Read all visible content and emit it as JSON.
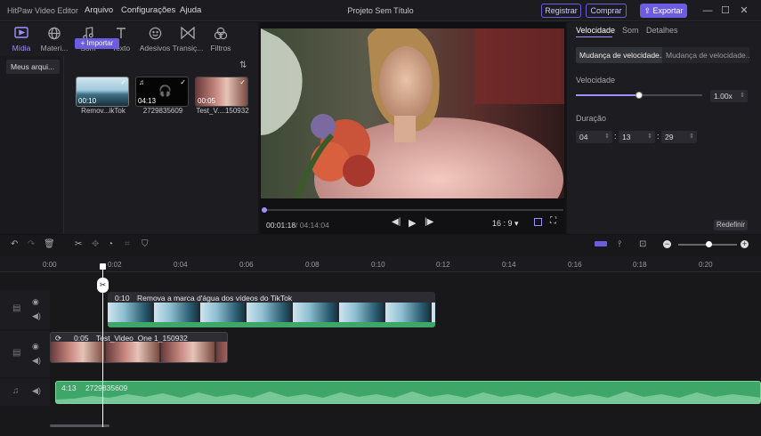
{
  "app": {
    "name": "HitPaw Video Editor",
    "project_title": "Projeto Sem Título",
    "menu": [
      "Arquivo",
      "Configurações",
      "Ajuda"
    ],
    "register_label": "Registrar",
    "buy_label": "Comprar",
    "export_label": "Exportar"
  },
  "media": {
    "tabs": [
      {
        "label": "Mídia",
        "icon": "media-icon",
        "active": true
      },
      {
        "label": "Materi...",
        "icon": "globe-icon",
        "active": false
      },
      {
        "label": "Som",
        "icon": "music-note-icon",
        "active": false
      },
      {
        "label": "Texto",
        "icon": "text-icon",
        "active": false
      },
      {
        "label": "Adesivos",
        "icon": "sticker-icon",
        "active": false
      },
      {
        "label": "Transiç...",
        "icon": "transition-icon",
        "active": false
      },
      {
        "label": "Filtros",
        "icon": "filter-icon",
        "active": false
      }
    ],
    "folder_label": "Meus arqui...",
    "import_label": "+ Importar",
    "items": [
      {
        "name": "Remov...ikTok",
        "duration": "00:10"
      },
      {
        "name": "2729835609",
        "duration": "04:13"
      },
      {
        "name": "Test_V....150932",
        "duration": "00:05"
      }
    ]
  },
  "preview": {
    "current_time": "00:01:18",
    "total_time": "/ 04:14:04",
    "aspect": "16 : 9",
    "progress": 0.005
  },
  "properties": {
    "tabs": [
      "Velocidade",
      "Som",
      "Detalhes"
    ],
    "segments": [
      "Mudança de velocidade...",
      "Mudança de velocidade..."
    ],
    "speed_label": "Velocidade",
    "speed_value": "1.00x",
    "speed_level": 0.5,
    "duration_label": "Duração",
    "duration": {
      "h": "04",
      "m": "13",
      "s": "29"
    },
    "reset_label": "Redefinir"
  },
  "timeline": {
    "ruler": [
      "0:00",
      "0:02",
      "0:04",
      "0:06",
      "0:08",
      "0:10",
      "0:12",
      "0:14",
      "0:16",
      "0:18",
      "0:20"
    ],
    "clips": {
      "video1": {
        "duration": "0:10",
        "title": "Remova a marca d'água dos vídeos do TikTok"
      },
      "video2": {
        "duration": "0:05",
        "title": "Test_Video_One 1_150932"
      },
      "audio": {
        "duration": "4:13",
        "title": "2729835609"
      }
    },
    "colors": {
      "accent": "#6b5ce0",
      "audio": "#3fa66a"
    }
  }
}
